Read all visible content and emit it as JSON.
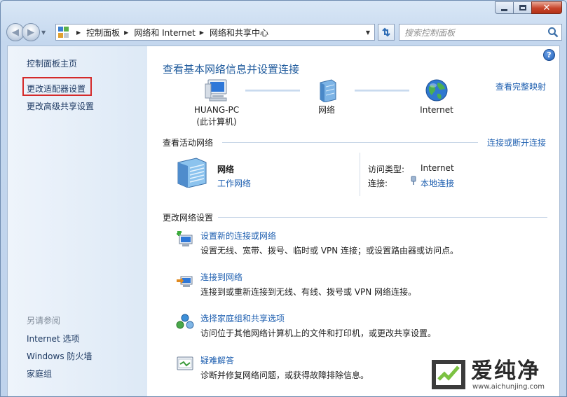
{
  "window": {
    "caption": {
      "minimize": "",
      "maximize": "",
      "close": "✕"
    }
  },
  "nav": {
    "breadcrumbs": [
      "控制面板",
      "网络和 Internet",
      "网络和共享中心"
    ],
    "search_placeholder": "搜索控制面板"
  },
  "sidebar": {
    "items": [
      "控制面板主页",
      "更改适配器设置",
      "更改高级共享设置"
    ],
    "see_also_title": "另请参阅",
    "see_also": [
      "Internet 选项",
      "Windows 防火墙",
      "家庭组"
    ]
  },
  "main": {
    "title": "查看基本网络信息并设置连接",
    "full_map_link": "查看完整映射",
    "map": {
      "computer_name": "HUANG-PC",
      "computer_note": "(此计算机)",
      "network_label": "网络",
      "internet_label": "Internet"
    },
    "active_section": {
      "heading": "查看活动网络",
      "link": "连接或断开连接",
      "network_name": "网络",
      "network_type": "工作网络",
      "access_type_label": "访问类型:",
      "access_type_value": "Internet",
      "connection_label": "连接:",
      "connection_value": "本地连接"
    },
    "change_section": {
      "heading": "更改网络设置",
      "tasks": [
        {
          "title": "设置新的连接或网络",
          "desc": "设置无线、宽带、拨号、临时或 VPN 连接；或设置路由器或访问点。"
        },
        {
          "title": "连接到网络",
          "desc": "连接到或重新连接到无线、有线、拨号或 VPN 网络连接。"
        },
        {
          "title": "选择家庭组和共享选项",
          "desc": "访问位于其他网络计算机上的文件和打印机，或更改共享设置。"
        },
        {
          "title": "疑难解答",
          "desc": "诊断并修复网络问题，或获得故障排除信息。"
        }
      ]
    }
  },
  "watermark": {
    "title": "爱纯净",
    "url": "www.aichunjing.com"
  },
  "colors": {
    "link": "#1e5fb0",
    "title": "#1e5a9c",
    "highlight": "#d42a2a"
  }
}
